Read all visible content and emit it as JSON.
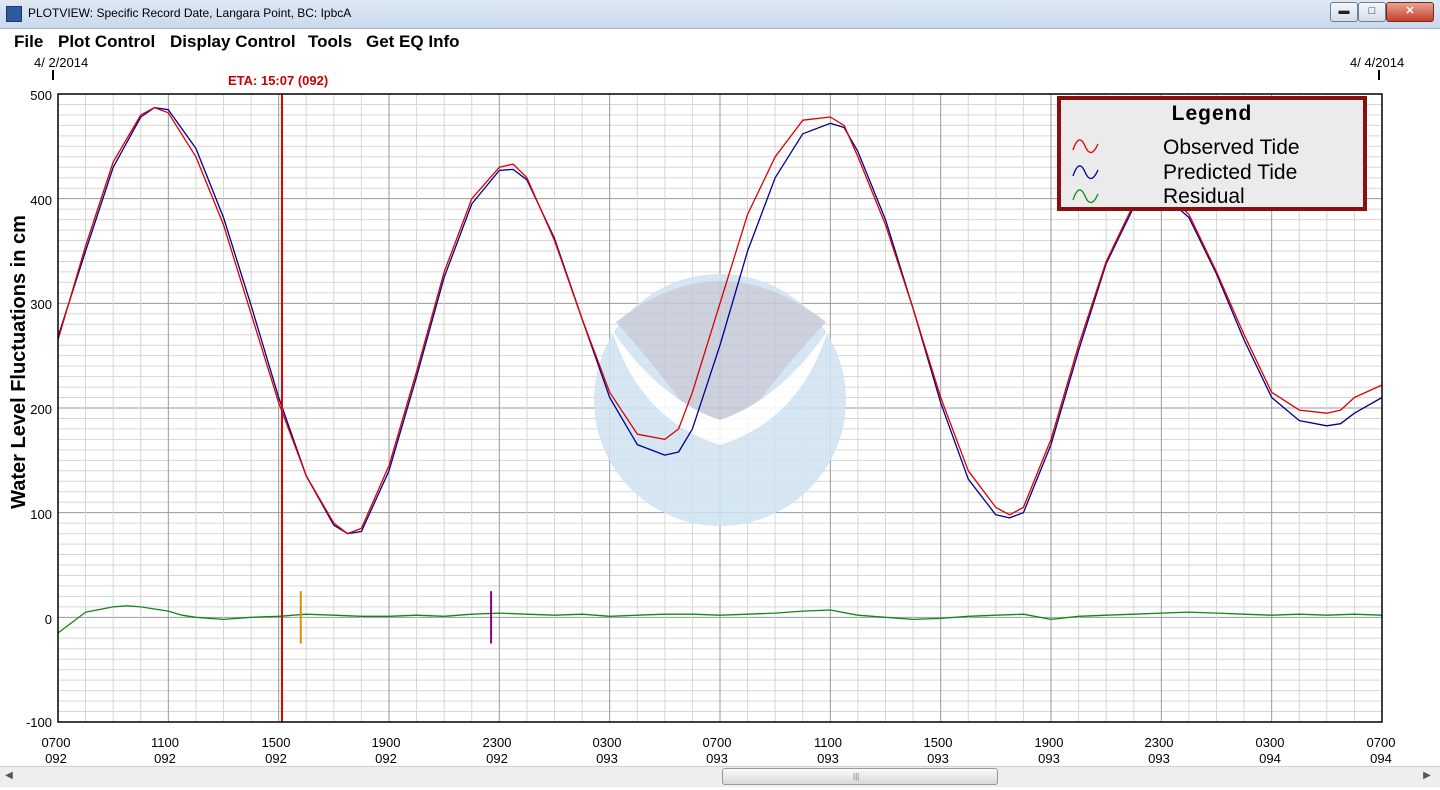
{
  "window": {
    "title": "PLOTVIEW: Specific Record Date, Langara Point, BC: IpbcA",
    "buttons": {
      "minimize": "▬",
      "maximize": "□",
      "close": "✕"
    }
  },
  "menu": {
    "items": [
      "File",
      "Plot Control",
      "Display Control",
      "Tools",
      "Get EQ Info"
    ]
  },
  "plot": {
    "start_date": "4/ 2/2014",
    "end_date": "4/ 4/2014",
    "eta_label": "ETA: 15:07 (092)",
    "colors": {
      "observed": "#dd0000",
      "predicted": "#00008b",
      "residual": "#118811",
      "eta_line": "#dd0000",
      "marker_orange": "#e08a00",
      "marker_purple": "#8b008b",
      "legend_border": "#8b0e0e"
    }
  },
  "legend": {
    "title": "Legend",
    "entries": [
      {
        "label": "Observed Tide",
        "color": "#dd0000"
      },
      {
        "label": "Predicted Tide",
        "color": "#00008b"
      },
      {
        "label": "Residual",
        "color": "#118811"
      }
    ]
  },
  "chart_data": {
    "type": "line",
    "ylabel": "Water Level Fluctuations in cm",
    "xlabel": "",
    "ylim": [
      -100,
      500
    ],
    "yticks": [
      "500",
      "400",
      "300",
      "200",
      "100",
      "0",
      "-100"
    ],
    "xticks": [
      {
        "time": "0700",
        "day": "092"
      },
      {
        "time": "1100",
        "day": "092"
      },
      {
        "time": "1500",
        "day": "092"
      },
      {
        "time": "1900",
        "day": "092"
      },
      {
        "time": "2300",
        "day": "092"
      },
      {
        "time": "0300",
        "day": "093"
      },
      {
        "time": "0700",
        "day": "093"
      },
      {
        "time": "1100",
        "day": "093"
      },
      {
        "time": "1500",
        "day": "093"
      },
      {
        "time": "1900",
        "day": "093"
      },
      {
        "time": "2300",
        "day": "093"
      },
      {
        "time": "0300",
        "day": "094"
      },
      {
        "time": "0700",
        "day": "094"
      }
    ],
    "x_range_hours": [
      0,
      48
    ],
    "eta_hour": 8.12,
    "markers": [
      {
        "hour": 8.8,
        "color": "#e08a00",
        "range": [
          -25,
          25
        ]
      },
      {
        "hour": 15.7,
        "color": "#8b008b",
        "range": [
          -25,
          25
        ]
      }
    ],
    "grid": true,
    "series": [
      {
        "name": "Observed Tide",
        "x": [
          0,
          1,
          2,
          3,
          3.5,
          4,
          5,
          6,
          7,
          8,
          9,
          10,
          10.5,
          11,
          12,
          13,
          14,
          15,
          16,
          16.5,
          17,
          18,
          19,
          20,
          21,
          22,
          22.5,
          23,
          24,
          25,
          26,
          27,
          28,
          28.5,
          29,
          30,
          31,
          32,
          33,
          34,
          34.5,
          35,
          36,
          37,
          38,
          39,
          40,
          41,
          42,
          43,
          44,
          45,
          46,
          46.5,
          47,
          48
        ],
        "y": [
          265,
          355,
          435,
          480,
          487,
          482,
          440,
          375,
          290,
          205,
          135,
          90,
          80,
          85,
          145,
          235,
          330,
          400,
          430,
          433,
          420,
          360,
          285,
          215,
          175,
          170,
          180,
          215,
          300,
          385,
          440,
          475,
          478,
          470,
          440,
          375,
          295,
          210,
          140,
          105,
          98,
          105,
          170,
          260,
          340,
          395,
          410,
          385,
          330,
          270,
          215,
          198,
          195,
          198,
          210,
          222
        ]
      },
      {
        "name": "Predicted Tide",
        "x": [
          0,
          1,
          2,
          3,
          3.5,
          4,
          5,
          6,
          7,
          8,
          9,
          10,
          10.5,
          11,
          12,
          13,
          14,
          15,
          16,
          16.5,
          17,
          18,
          19,
          20,
          21,
          22,
          22.5,
          23,
          24,
          25,
          26,
          27,
          28,
          28.5,
          29,
          30,
          31,
          32,
          33,
          34,
          34.5,
          35,
          36,
          37,
          38,
          39,
          40,
          41,
          42,
          43,
          44,
          45,
          46,
          46.5,
          47,
          48
        ],
        "y": [
          268,
          350,
          430,
          478,
          487,
          485,
          448,
          382,
          298,
          210,
          135,
          88,
          80,
          82,
          140,
          230,
          325,
          395,
          427,
          428,
          418,
          362,
          285,
          210,
          165,
          155,
          158,
          180,
          260,
          350,
          420,
          462,
          472,
          468,
          445,
          380,
          295,
          205,
          132,
          98,
          95,
          100,
          165,
          255,
          338,
          392,
          405,
          382,
          328,
          265,
          210,
          188,
          183,
          185,
          195,
          210
        ]
      },
      {
        "name": "Residual",
        "x": [
          0,
          1,
          2,
          2.5,
          3,
          4,
          4.5,
          5,
          6,
          7,
          8,
          9,
          10,
          11,
          12,
          13,
          14,
          15,
          16,
          17,
          18,
          19,
          20,
          21,
          22,
          23,
          24,
          25,
          26,
          27,
          28,
          29,
          30,
          31,
          32,
          33,
          34,
          35,
          36,
          37,
          38,
          39,
          40,
          41,
          42,
          43,
          44,
          45,
          46,
          47,
          48
        ],
        "y": [
          -15,
          5,
          10,
          11,
          10,
          6,
          2,
          0,
          -2,
          0,
          1,
          3,
          2,
          1,
          1,
          2,
          1,
          3,
          4,
          3,
          2,
          3,
          1,
          2,
          3,
          3,
          2,
          3,
          4,
          6,
          7,
          2,
          0,
          -2,
          -1,
          1,
          2,
          3,
          -2,
          1,
          2,
          3,
          4,
          5,
          4,
          3,
          2,
          3,
          2,
          3,
          2
        ]
      }
    ]
  }
}
